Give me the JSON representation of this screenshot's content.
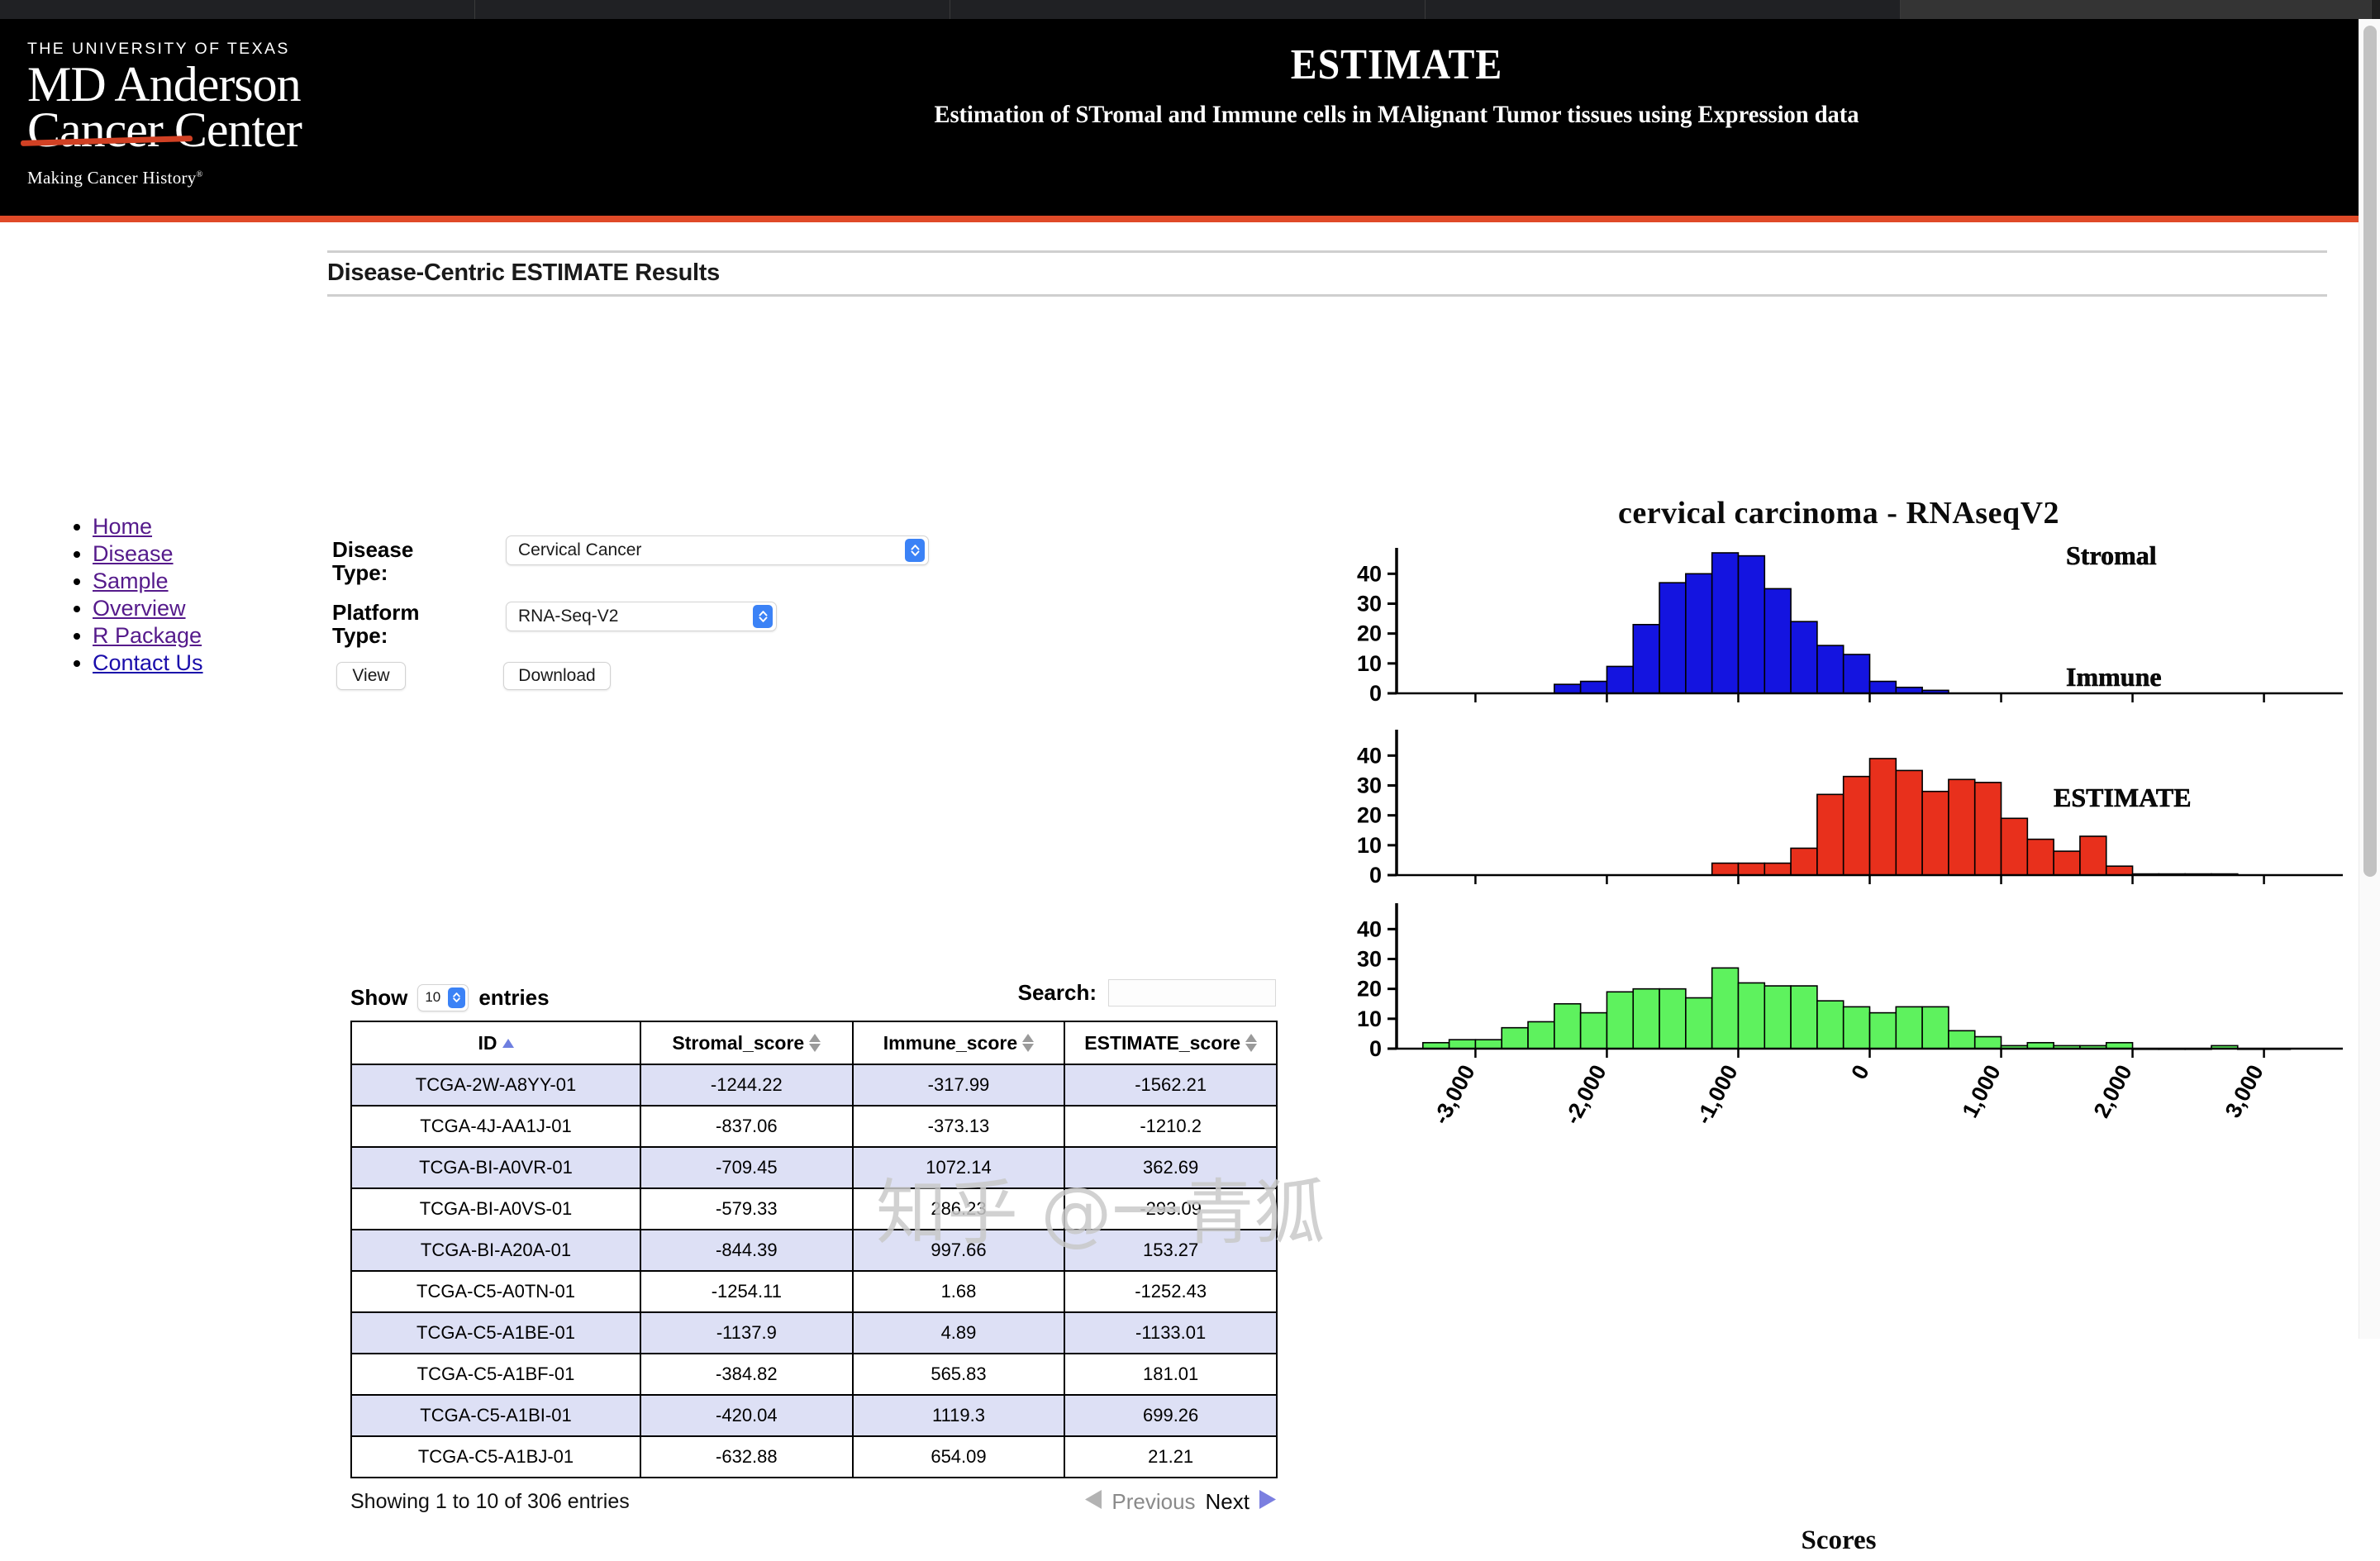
{
  "browser": {
    "tabs": [
      "",
      "",
      "",
      "",
      ""
    ],
    "scrollbar": "vertical-scrollbar"
  },
  "masthead": {
    "logo": {
      "university": "THE UNIVERSITY OF TEXAS",
      "wordmark_line1": "MD Anderson",
      "wordmark_line2": "Cancer Center",
      "tagline": "Making Cancer History",
      "tagline_mark": "®"
    },
    "site_title": "ESTIMATE",
    "site_subtitle": "Estimation of STromal and Immune cells in MAlignant Tumor tissues using Expression data",
    "accent_color": "#e04a28"
  },
  "nav": {
    "items": [
      {
        "label": "Home",
        "state": "visited"
      },
      {
        "label": "Disease",
        "state": "visited"
      },
      {
        "label": "Sample",
        "state": "visited"
      },
      {
        "label": "Overview",
        "state": "visited"
      },
      {
        "label": "R Package",
        "state": "visited"
      },
      {
        "label": "Contact Us",
        "state": "unvisited"
      }
    ],
    "visited_color": "#551a8b",
    "unvisited_color": "#1a0dab"
  },
  "page": {
    "results_heading": "Disease-Centric ESTIMATE Results"
  },
  "form": {
    "disease_label": "Disease Type:",
    "disease_value": "Cervical Cancer",
    "platform_label": "Platform Type:",
    "platform_value": "RNA-Seq-V2",
    "view_button": "View",
    "download_button": "Download"
  },
  "datatable": {
    "show_label": "Show",
    "entries_label": "entries",
    "page_length": "10",
    "search_label": "Search:",
    "search_value": "",
    "search_placeholder": "",
    "columns": [
      {
        "label": "ID",
        "sort": "asc"
      },
      {
        "label": "Stromal_score",
        "sort": "none"
      },
      {
        "label": "Immune_score",
        "sort": "none"
      },
      {
        "label": "ESTIMATE_score",
        "sort": "none"
      }
    ],
    "rows": [
      [
        "TCGA-2W-A8YY-01",
        "-1244.22",
        "-317.99",
        "-1562.21"
      ],
      [
        "TCGA-4J-AA1J-01",
        "-837.06",
        "-373.13",
        "-1210.2"
      ],
      [
        "TCGA-BI-A0VR-01",
        "-709.45",
        "1072.14",
        "362.69"
      ],
      [
        "TCGA-BI-A0VS-01",
        "-579.33",
        "286.23",
        "-293.09"
      ],
      [
        "TCGA-BI-A20A-01",
        "-844.39",
        "997.66",
        "153.27"
      ],
      [
        "TCGA-C5-A0TN-01",
        "-1254.11",
        "1.68",
        "-1252.43"
      ],
      [
        "TCGA-C5-A1BE-01",
        "-1137.9",
        "4.89",
        "-1133.01"
      ],
      [
        "TCGA-C5-A1BF-01",
        "-384.82",
        "565.83",
        "181.01"
      ],
      [
        "TCGA-C5-A1BI-01",
        "-420.04",
        "1119.3",
        "699.26"
      ],
      [
        "TCGA-C5-A1BJ-01",
        "-632.88",
        "654.09",
        "21.21"
      ]
    ],
    "info": "Showing 1 to 10 of 306 entries",
    "previous_label": "Previous",
    "next_label": "Next",
    "previous_enabled": false,
    "next_enabled": true,
    "row_stripe_color": "#dde0f5"
  },
  "watermark": {
    "text": "知乎 @一青狐"
  },
  "chart_data": [
    {
      "type": "bar",
      "title": "cervical carcinoma - RNAseqV2",
      "panel": "Stromal",
      "color": "#1414e0",
      "xlabel": "Scores",
      "ylabel": "",
      "ylim": [
        0,
        47
      ],
      "yticks": [
        0,
        10,
        20,
        30,
        40
      ],
      "xlim": [
        -3600,
        3600
      ],
      "xticks": [
        -3000,
        -2000,
        -1000,
        0,
        1000,
        2000,
        3000
      ],
      "xticklabels": [
        "-3,000",
        "-2,000",
        "-1,000",
        "0",
        "1,000",
        "2,000",
        "3,000"
      ],
      "bin_width": 200,
      "bin_starts": [
        -2400,
        -2200,
        -2000,
        -1800,
        -1600,
        -1400,
        -1200,
        -1000,
        -800,
        -600,
        -400,
        -200,
        0,
        200,
        400
      ],
      "values": [
        3,
        4,
        9,
        23,
        37,
        40,
        47,
        46,
        35,
        24,
        16,
        13,
        4,
        2,
        1
      ],
      "grid": false
    },
    {
      "type": "bar",
      "title": "",
      "panel": "Immune",
      "color": "#e8301c",
      "xlabel": "Scores",
      "ylabel": "",
      "ylim": [
        0,
        47
      ],
      "yticks": [
        0,
        10,
        20,
        30,
        40
      ],
      "xlim": [
        -3600,
        3600
      ],
      "xticks": [
        -3000,
        -2000,
        -1000,
        0,
        1000,
        2000,
        3000
      ],
      "xticklabels": [
        "-3,000",
        "-2,000",
        "-1,000",
        "0",
        "1,000",
        "2,000",
        "3,000"
      ],
      "bin_width": 200,
      "bin_starts": [
        -1200,
        -1000,
        -800,
        -600,
        -400,
        -200,
        0,
        200,
        400,
        600,
        800,
        1000,
        1200,
        1400,
        1600,
        1800,
        2000,
        2200,
        2400,
        2600
      ],
      "values": [
        4,
        4,
        4,
        9,
        27,
        33,
        39,
        35,
        28,
        32,
        31,
        19,
        12,
        8,
        13,
        3,
        0.4,
        0.4,
        0.4,
        0.4
      ],
      "grid": false
    },
    {
      "type": "bar",
      "title": "",
      "panel": "ESTIMATE",
      "color": "#5ef25e",
      "xlabel": "Scores",
      "ylabel": "",
      "ylim": [
        0,
        47
      ],
      "yticks": [
        0,
        10,
        20,
        30,
        40
      ],
      "xlim": [
        -3600,
        3600
      ],
      "xticks": [
        -3000,
        -2000,
        -1000,
        0,
        1000,
        2000,
        3000
      ],
      "xticklabels": [
        "-3,000",
        "-2,000",
        "-1,000",
        "0",
        "1,000",
        "2,000",
        "3,000"
      ],
      "bin_width": 200,
      "bin_starts": [
        -3400,
        -3200,
        -3000,
        -2800,
        -2600,
        -2400,
        -2200,
        -2000,
        -1800,
        -1600,
        -1400,
        -1200,
        -1000,
        -800,
        -600,
        -400,
        -200,
        0,
        200,
        400,
        600,
        800,
        1000,
        1200,
        1400,
        1600,
        1800,
        2000,
        2200,
        2400,
        2600,
        2800,
        3000
      ],
      "values": [
        2,
        3,
        3,
        7,
        9,
        15,
        12,
        19,
        20,
        20,
        17,
        27,
        22,
        21,
        21,
        16,
        14,
        12,
        14,
        14,
        6,
        4,
        1,
        2,
        1,
        1,
        2,
        0,
        0,
        0,
        1,
        0,
        0
      ],
      "grid": false
    }
  ]
}
